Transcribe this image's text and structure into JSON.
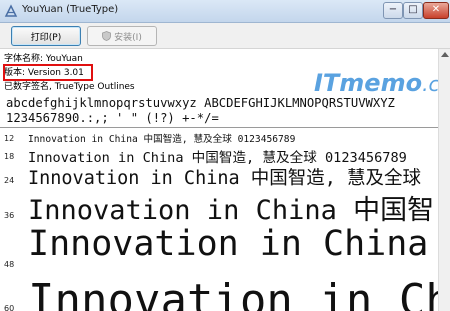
{
  "window": {
    "title": "YouYuan (TrueType)",
    "min_label": "−",
    "max_label": "□",
    "close_label": "✕"
  },
  "toolbar": {
    "print_label": "打印(P)",
    "install_label": "安装(I)"
  },
  "info": {
    "font_name": "字体名称: YouYuan",
    "version": "版本: Version 3.01",
    "signature": "已数字签名, TrueType Outlines"
  },
  "alphabet": {
    "line1": "abcdefghijklmnopqrstuvwxyz ABCDEFGHIJKLMNOPQRSTUVWXYZ",
    "line2": "1234567890.:,; ' \" (!?) +-*/="
  },
  "samples": [
    {
      "size": "12",
      "text": "Innovation in China 中国智造, 慧及全球 0123456789"
    },
    {
      "size": "18",
      "text": "Innovation in China 中国智造, 慧及全球 0123456789"
    },
    {
      "size": "24",
      "text": "Innovation in China 中国智造, 慧及全球"
    },
    {
      "size": "36",
      "text": "Innovation in China 中国智"
    },
    {
      "size": "48",
      "text": "Innovation in China"
    },
    {
      "size": "60",
      "text": "Innovation in Ch"
    }
  ],
  "watermark": {
    "main": "ITmemo",
    "suffix": ".cn"
  },
  "colors": {
    "highlight": "#e01010",
    "watermark": "#5aa2e0"
  }
}
